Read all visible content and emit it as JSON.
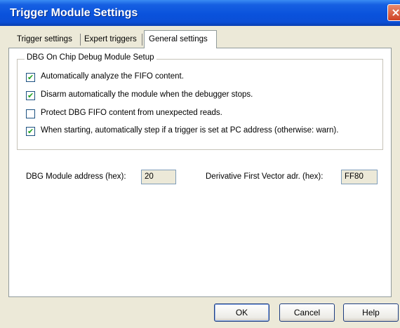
{
  "window": {
    "title": "Trigger Module Settings",
    "close_glyph": "×"
  },
  "tabs": [
    {
      "label": "Trigger settings",
      "active": false
    },
    {
      "label": "Expert triggers",
      "active": false
    },
    {
      "label": "General settings",
      "active": true
    }
  ],
  "group": {
    "title": "DBG On Chip Debug Module Setup",
    "options": [
      {
        "label": "Automatically analyze the FIFO content.",
        "checked": true
      },
      {
        "label": "Disarm automatically the module when the debugger stops.",
        "checked": true
      },
      {
        "label": "Protect DBG FIFO content from unexpected reads.",
        "checked": false
      },
      {
        "label": "When starting, automatically step if a trigger is set at PC address (otherwise: warn).",
        "checked": true
      }
    ]
  },
  "fields": {
    "dbg_address_label": "DBG Module address (hex):",
    "dbg_address_value": "20",
    "vector_label": "Derivative First Vector adr. (hex):",
    "vector_value": "FF80"
  },
  "buttons": {
    "ok": "OK",
    "cancel": "Cancel",
    "help": "Help"
  },
  "colors": {
    "title_bar": "#0b4fd6",
    "dialog_bg": "#ece9d8",
    "check_mark": "#21a121"
  }
}
